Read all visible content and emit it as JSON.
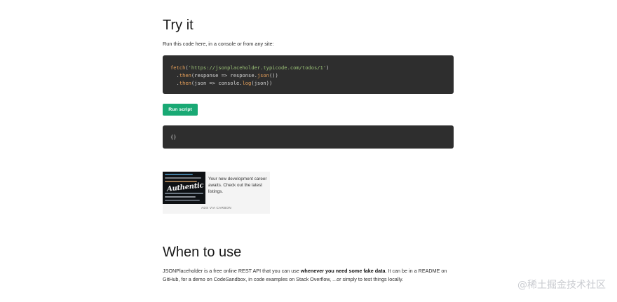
{
  "try_section": {
    "title": "Try it",
    "intro": "Run this code here, in a console or from any site:"
  },
  "code": {
    "line1_fn": "fetch",
    "line1_open": "(",
    "line1_url": "'https://jsonplaceholder.typicode.com/todos/1'",
    "line1_close": ")",
    "line2_prefix": "  .",
    "line2_then": "then",
    "line2_mid": "(response => response.",
    "line2_json": "json",
    "line2_end": "())",
    "line3_prefix": "  .",
    "line3_then": "then",
    "line3_mid": "(json => console.",
    "line3_log": "log",
    "line3_end": "(json))"
  },
  "run_button": {
    "label": "Run script",
    "color": "#19a974"
  },
  "result": {
    "output": "{}"
  },
  "ad": {
    "image_text": "Authentic",
    "text": "Your new development career awaits. Check out the latest listings.",
    "via": "ADS VIA CARBON"
  },
  "when_section": {
    "title": "When to use",
    "text_before": "JSONPlaceholder is a free online REST API that you can use ",
    "text_bold": "whenever you need some fake data",
    "text_after": ". It can be in a README on GitHub, for a demo on CodeSandbox, in code examples on Stack Overflow, ...or simply to test things locally."
  },
  "watermark": {
    "text": "@稀土掘金技术社区"
  }
}
